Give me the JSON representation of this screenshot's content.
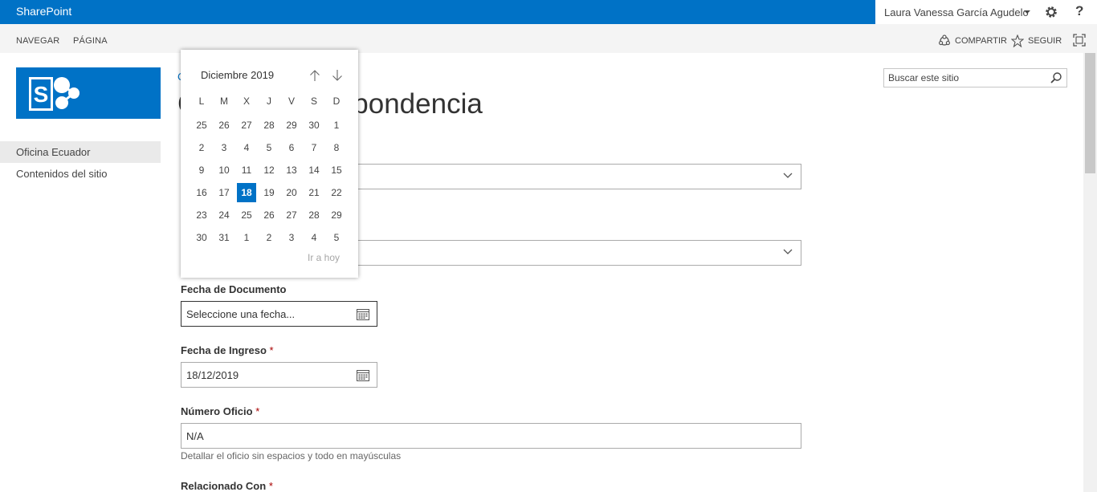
{
  "suite_bar": {
    "brand": "SharePoint",
    "user_name": "Laura Vanessa García Agudelo",
    "help": "?"
  },
  "ribbon": {
    "tabs": [
      "NAVEGAR",
      "PÁGINA"
    ],
    "share": "COMPARTIR",
    "follow": "SEGUIR"
  },
  "left_nav": {
    "items": [
      "Oficina Ecuador",
      "Contenidos del sitio"
    ]
  },
  "search": {
    "placeholder": "Buscar este sitio"
  },
  "page": {
    "breadcrumb": "C",
    "title": "C",
    "title_tail": "pondencia"
  },
  "calendar": {
    "month_label": "Diciembre 2019",
    "day_headers": [
      "L",
      "M",
      "X",
      "J",
      "V",
      "S",
      "D"
    ],
    "weeks": [
      [
        "25",
        "26",
        "27",
        "28",
        "29",
        "30",
        "1"
      ],
      [
        "2",
        "3",
        "4",
        "5",
        "6",
        "7",
        "8"
      ],
      [
        "9",
        "10",
        "11",
        "12",
        "13",
        "14",
        "15"
      ],
      [
        "16",
        "17",
        "18",
        "19",
        "20",
        "21",
        "22"
      ],
      [
        "23",
        "24",
        "25",
        "26",
        "27",
        "28",
        "29"
      ],
      [
        "30",
        "31",
        "1",
        "2",
        "3",
        "4",
        "5"
      ]
    ],
    "selected_day": "18",
    "go_today": "Ir a hoy"
  },
  "form": {
    "fecha_documento": {
      "label": "Fecha de Documento",
      "placeholder": "Seleccione una fecha..."
    },
    "fecha_ingreso": {
      "label": "Fecha de Ingreso",
      "required": "*",
      "value": "18/12/2019"
    },
    "numero_oficio": {
      "label": "Número Oficio",
      "required": "*",
      "value": "N/A",
      "hint": "Detallar el oficio sin espacios y todo en mayúsculas"
    },
    "relacionado_con": {
      "label": "Relacionado Con",
      "required": "*"
    }
  },
  "colors": {
    "brand": "#0072c6",
    "required": "#a80000"
  }
}
